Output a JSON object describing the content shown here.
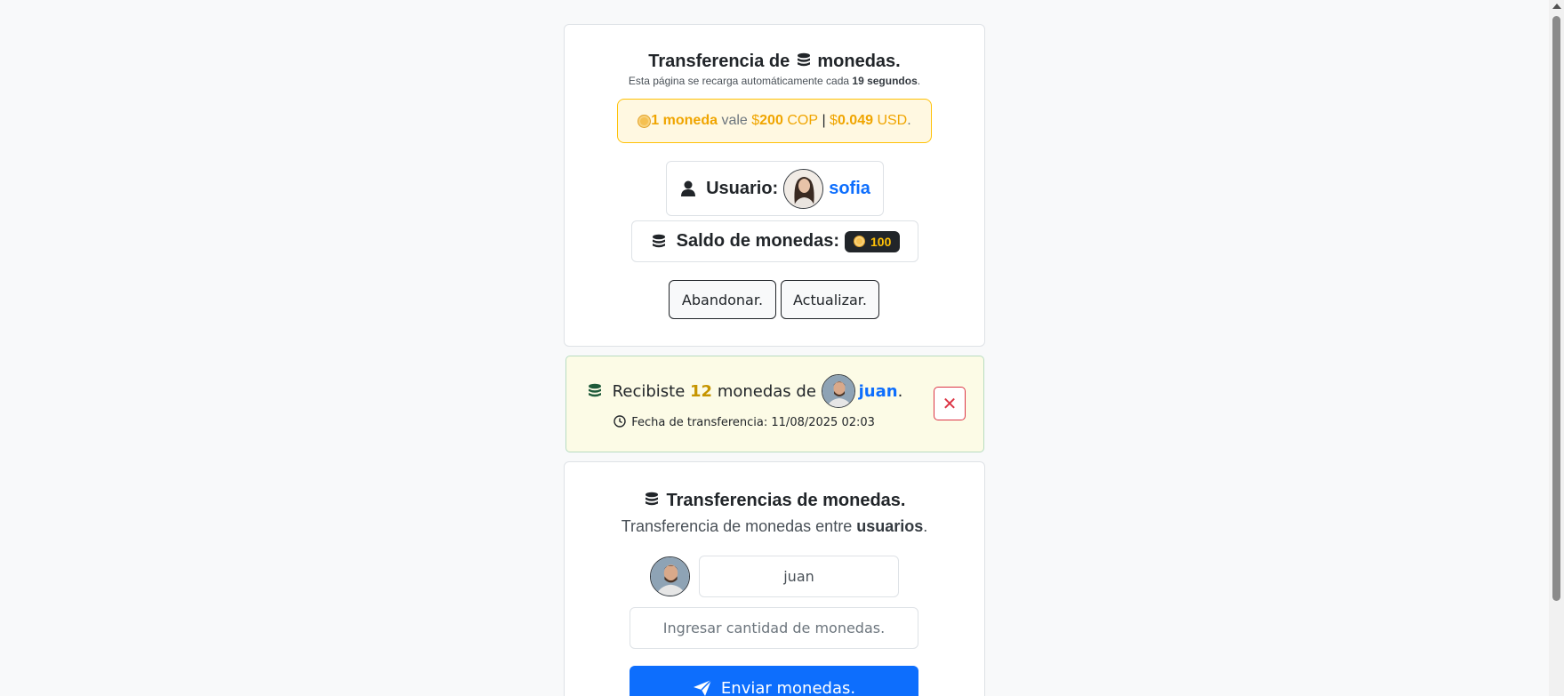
{
  "header": {
    "title_pre": "Transferencia de",
    "title_post": "monedas.",
    "reload_pre": "Esta página se recarga automáticamente cada",
    "reload_seconds": "19 segundos",
    "reload_post": "."
  },
  "rate": {
    "amount": "1 moneda",
    "vale": "vale",
    "cop_symbol": "$",
    "cop_value": "200",
    "cop_unit": "COP",
    "sep": "|",
    "usd_symbol": "$",
    "usd_value": "0.049",
    "usd_unit": "USD",
    "end": "."
  },
  "user": {
    "label": "Usuario:",
    "name": "sofia"
  },
  "balance": {
    "label": "Saldo de monedas:",
    "value": "100"
  },
  "actions": {
    "abandon": "Abandonar.",
    "update": "Actualizar."
  },
  "notification": {
    "pre": "Recibiste",
    "amount": "12",
    "mid": "monedas de",
    "sender": "juan",
    "end": ".",
    "date_label": "Fecha de transferencia:",
    "date_value": "11/08/2025 02:03",
    "close": "✕"
  },
  "transfer": {
    "title": "Transferencias de monedas.",
    "subtitle_pre": "Transferencia de monedas entre",
    "subtitle_bold": "usuarios",
    "subtitle_end": ".",
    "recipient_value": "juan",
    "amount_placeholder": "Ingresar cantidad de monedas.",
    "send_label": "Enviar monedas."
  },
  "colors": {
    "primary": "#0d6efd",
    "gold": "#ffc107",
    "danger": "#dc3545"
  }
}
